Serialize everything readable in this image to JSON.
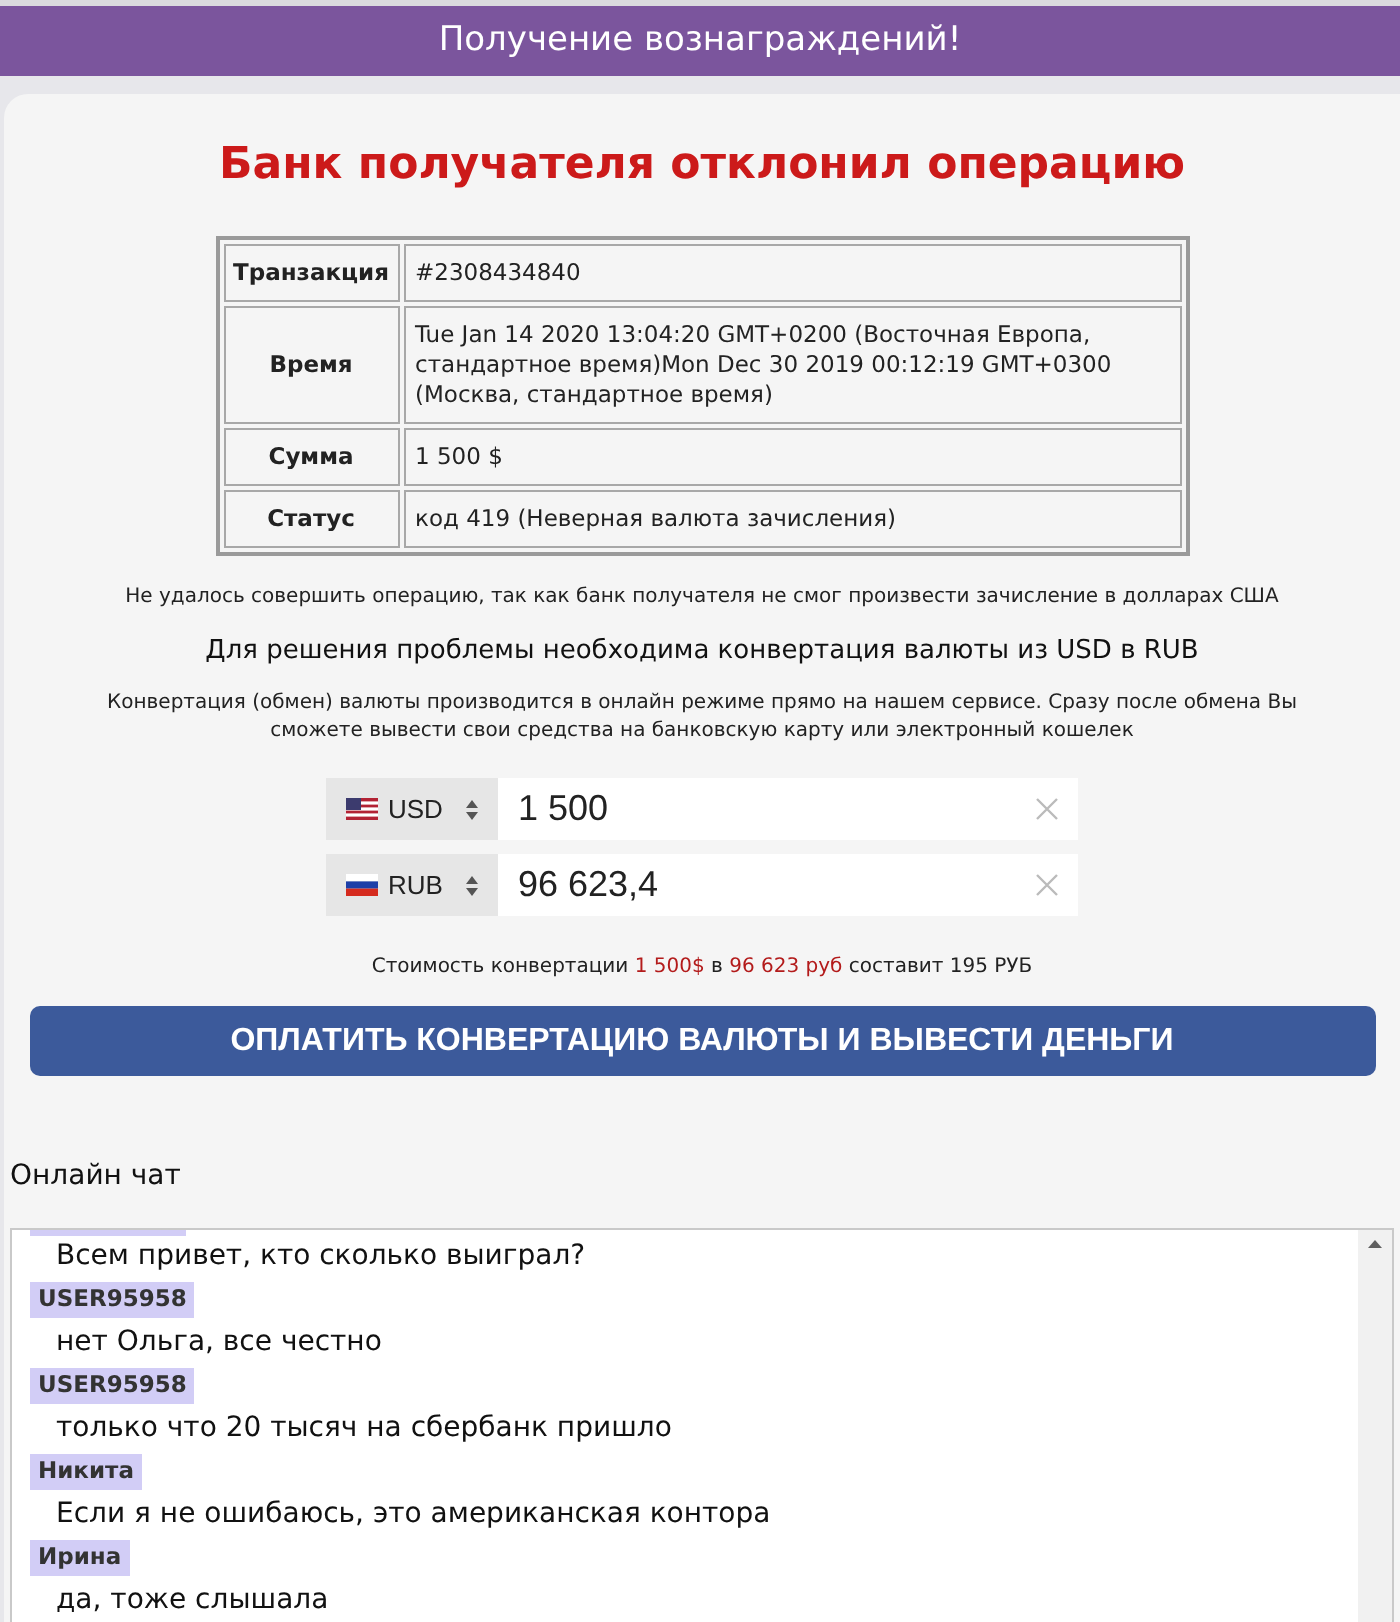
{
  "header": {
    "title": "Получение вознаграждений!"
  },
  "error": {
    "title": "Банк получателя отклонил операцию"
  },
  "details": [
    {
      "label": "Транзакция",
      "value": "#2308434840"
    },
    {
      "label": "Время",
      "value": "Tue Jan 14 2020 13:04:20 GMT+0200 (Восточная Европа, стандартное время)Mon Dec 30 2019 00:12:19 GMT+0300 (Москва, стандартное время)"
    },
    {
      "label": "Сумма",
      "value": "1 500 $"
    },
    {
      "label": "Статус",
      "value": "код 419 (Неверная валюта зачисления)"
    }
  ],
  "notice": "Не удалось совершить операцию, так как банк получателя не смог произвести зачисление в долларах США",
  "solution": {
    "heading": "Для решения проблемы необходима конвертация валюты из USD в RUB",
    "text": "Конвертация (обмен) валюты производится в онлайн режиме прямо на нашем сервисе. Сразу после обмена Вы сможете вывести свои средства на банковскую карту или электронный кошелек"
  },
  "converter": {
    "rows": [
      {
        "kind": "us",
        "currency": "USD",
        "value": "1 500"
      },
      {
        "kind": "ru",
        "currency": "RUB",
        "value": "96 623,4"
      }
    ],
    "cost": [
      {
        "text": "Стоимость конвертации ",
        "highlight": false
      },
      {
        "text": "1 500$",
        "highlight": true
      },
      {
        "text": " в ",
        "highlight": false
      },
      {
        "text": "96 623 руб",
        "highlight": true
      },
      {
        "text": " составит 195 РУБ",
        "highlight": false
      }
    ]
  },
  "pay_button": {
    "label": "ОПЛАТИТЬ КОНВЕРТАЦИЮ ВАЛЮТЫ И ВЫВЕСТИ ДЕНЬГИ"
  },
  "chat": {
    "title": "Онлайн чат",
    "messages": [
      {
        "author_clipped": true,
        "text": "Всем привет, кто сколько выиграл?"
      },
      {
        "author": "USER95958",
        "text": "нет Ольга, все честно"
      },
      {
        "author": "USER95958",
        "text": "только что 20 тысяч на сбербанк пришло"
      },
      {
        "author": "Никита",
        "text": "Если я не ошибаюсь, это американская контора"
      },
      {
        "author": "Ирина",
        "text": "да, тоже слышала"
      }
    ]
  }
}
